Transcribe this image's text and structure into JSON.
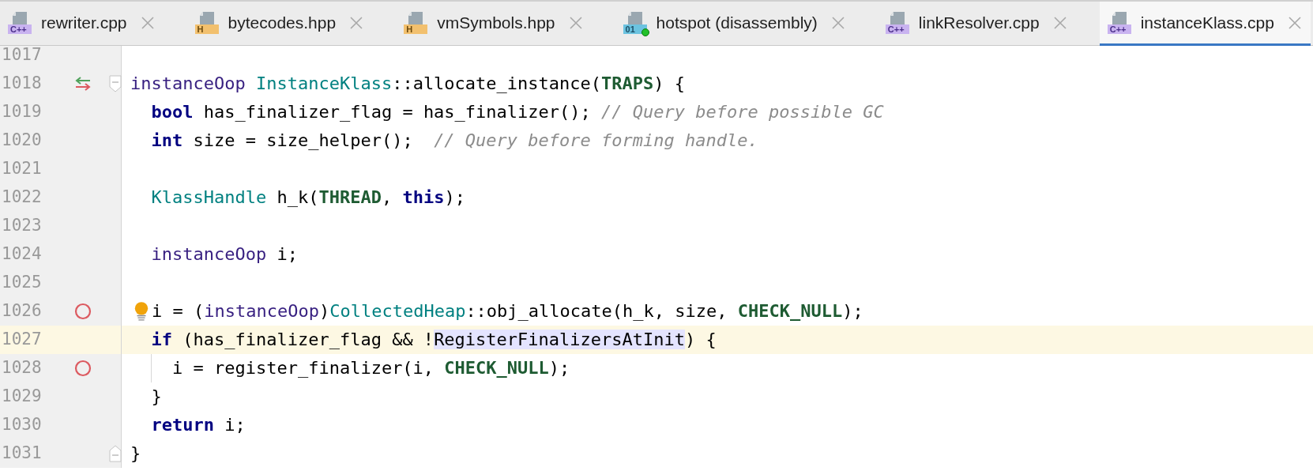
{
  "tabs": [
    {
      "label": "rewriter.cpp",
      "badge": "C++",
      "kind": "cpp",
      "selected": false
    },
    {
      "label": "bytecodes.hpp",
      "badge": "H",
      "kind": "hpp",
      "selected": false
    },
    {
      "label": "vmSymbols.hpp",
      "badge": "H",
      "kind": "hpp",
      "selected": false
    },
    {
      "label": "hotspot (disassembly)",
      "badge": "01",
      "kind": "disassembly",
      "selected": false
    },
    {
      "label": "linkResolver.cpp",
      "badge": "C++",
      "kind": "cpp",
      "selected": false
    },
    {
      "label": "instanceKlass.cpp",
      "badge": "C++",
      "kind": "cpp",
      "selected": true
    }
  ],
  "lines": [
    {
      "number": "1017"
    },
    {
      "number": "1018",
      "override_marker": true,
      "fold_start": true,
      "segments": [
        {
          "text": "instanceOop ",
          "kind": "type"
        },
        {
          "text": "InstanceKlass",
          "kind": "class"
        },
        {
          "text": "::allocate_instance(",
          "kind": "plain"
        },
        {
          "text": "TRAPS",
          "kind": "macro"
        },
        {
          "text": ") {",
          "kind": "plain"
        }
      ]
    },
    {
      "number": "1019",
      "segments": [
        {
          "text": "  bool",
          "kind": "keyword"
        },
        {
          "text": " has_finalizer_flag = has_finalizer(); ",
          "kind": "plain"
        },
        {
          "text": "// Query before possible GC",
          "kind": "comment"
        }
      ]
    },
    {
      "number": "1020",
      "segments": [
        {
          "text": "  int",
          "kind": "keyword"
        },
        {
          "text": " size = size_helper();  ",
          "kind": "plain"
        },
        {
          "text": "// Query before forming handle.",
          "kind": "comment"
        }
      ]
    },
    {
      "number": "1021"
    },
    {
      "number": "1022",
      "segments": [
        {
          "text": "  KlassHandle",
          "kind": "class"
        },
        {
          "text": " h_k(",
          "kind": "plain"
        },
        {
          "text": "THREAD",
          "kind": "macro"
        },
        {
          "text": ", ",
          "kind": "plain"
        },
        {
          "text": "this",
          "kind": "keyword"
        },
        {
          "text": ");",
          "kind": "plain"
        }
      ]
    },
    {
      "number": "1023"
    },
    {
      "number": "1024",
      "segments": [
        {
          "text": "  instanceOop",
          "kind": "type"
        },
        {
          "text": " i;",
          "kind": "plain"
        }
      ]
    },
    {
      "number": "1025"
    },
    {
      "number": "1026",
      "breakpoint": true,
      "lightbulb": true,
      "segments": [
        {
          "text": "i = (",
          "kind": "plain"
        },
        {
          "text": "instanceOop",
          "kind": "type"
        },
        {
          "text": ")",
          "kind": "plain"
        },
        {
          "text": "CollectedHeap",
          "kind": "class"
        },
        {
          "text": "::obj_allocate(h_k, size, ",
          "kind": "plain"
        },
        {
          "text": "CHECK_NULL",
          "kind": "macro"
        },
        {
          "text": ");",
          "kind": "plain"
        }
      ]
    },
    {
      "number": "1027",
      "current": true,
      "segments": [
        {
          "text": "  if",
          "kind": "keyword"
        },
        {
          "text": " (has_finalizer_flag && !",
          "kind": "plain"
        },
        {
          "text": "RegisterFinalizersAtInit",
          "kind": "plain",
          "highlighted": true
        },
        {
          "text": ") {",
          "kind": "plain"
        }
      ]
    },
    {
      "number": "1028",
      "breakpoint": true,
      "indent_guide": true,
      "segments": [
        {
          "text": "    i = register_finalizer(i, ",
          "kind": "plain"
        },
        {
          "text": "CHECK_NULL",
          "kind": "macro"
        },
        {
          "text": ");",
          "kind": "plain"
        }
      ]
    },
    {
      "number": "1029",
      "segments": [
        {
          "text": "  }",
          "kind": "plain"
        }
      ]
    },
    {
      "number": "1030",
      "segments": [
        {
          "text": "  return",
          "kind": "keyword"
        },
        {
          "text": " i;",
          "kind": "plain"
        }
      ]
    },
    {
      "number": "1031",
      "fold_end": true,
      "segments": [
        {
          "text": "}",
          "kind": "plain"
        }
      ]
    }
  ]
}
